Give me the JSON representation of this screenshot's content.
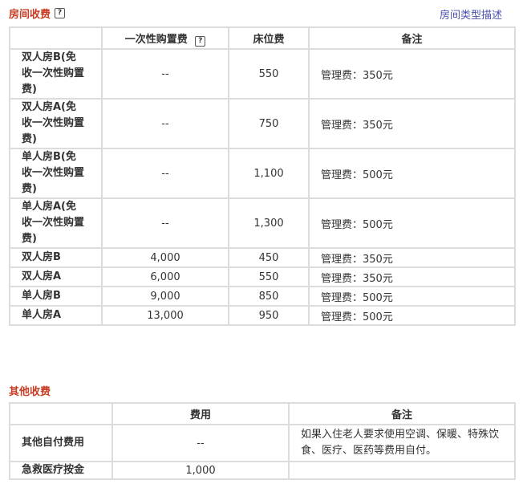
{
  "room_fees": {
    "title": "房间收费",
    "help": "?",
    "link": "房间类型描述",
    "headers": {
      "blank": "",
      "onetime": "一次性购置费",
      "bed": "床位费",
      "note": "备注"
    },
    "rows": [
      {
        "name": "双人房B(免收一次性购置费)",
        "onetime": "--",
        "bed": "550",
        "note": "管理费：350元"
      },
      {
        "name": "双人房A(免收一次性购置费)",
        "onetime": "--",
        "bed": "750",
        "note": "管理费：350元"
      },
      {
        "name": "单人房B(免收一次性购置费)",
        "onetime": "--",
        "bed": "1,100",
        "note": "管理费：500元"
      },
      {
        "name": "单人房A(免收一次性购置费)",
        "onetime": "--",
        "bed": "1,300",
        "note": "管理费：500元"
      },
      {
        "name": "双人房B",
        "onetime": "4,000",
        "bed": "450",
        "note": "管理费：350元"
      },
      {
        "name": "双人房A",
        "onetime": "6,000",
        "bed": "550",
        "note": "管理费：350元"
      },
      {
        "name": "单人房B",
        "onetime": "9,000",
        "bed": "850",
        "note": "管理费：500元"
      },
      {
        "name": "单人房A",
        "onetime": "13,000",
        "bed": "950",
        "note": "管理费：500元"
      }
    ]
  },
  "other_fees": {
    "title": "其他收费",
    "headers": {
      "blank": "",
      "fee": "费用",
      "note": "备注"
    },
    "rows": [
      {
        "name": "其他自付费用",
        "fee": "--",
        "note": "如果入住老人要求使用空调、保暖、特殊饮食、医疗、医药等费用自付。"
      },
      {
        "name": "急救医疗按金",
        "fee": "1,000",
        "note": ""
      }
    ]
  }
}
